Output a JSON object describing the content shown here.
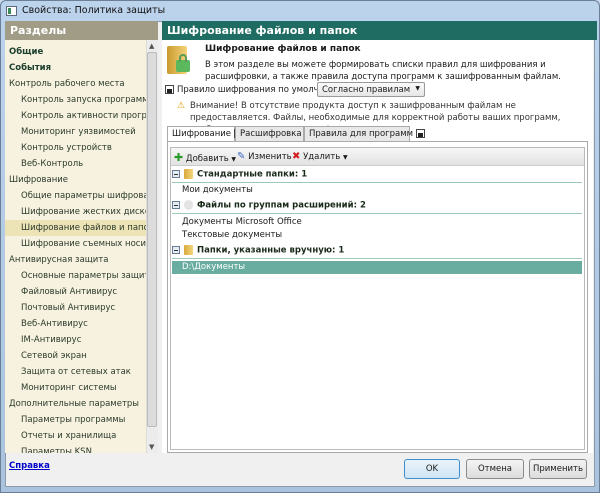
{
  "window": {
    "title": "Свойства: Политика защиты"
  },
  "sidebar": {
    "header": "Разделы",
    "items": [
      {
        "label": "Общие",
        "level": 0,
        "bold": true
      },
      {
        "label": "События",
        "level": 0,
        "bold": true
      },
      {
        "label": "Контроль рабочего места",
        "level": 0
      },
      {
        "label": "Контроль запуска программ",
        "level": 1
      },
      {
        "label": "Контроль активности программ",
        "level": 1
      },
      {
        "label": "Мониторинг уязвимостей",
        "level": 1
      },
      {
        "label": "Контроль устройств",
        "level": 1
      },
      {
        "label": "Веб-Контроль",
        "level": 1
      },
      {
        "label": "Шифрование",
        "level": 0
      },
      {
        "label": "Общие параметры шифрования",
        "level": 1
      },
      {
        "label": "Шифрование жестких дисков",
        "level": 1
      },
      {
        "label": "Шифрование файлов и папок",
        "level": 1,
        "selected": true
      },
      {
        "label": "Шифрование съемных носителей",
        "level": 1
      },
      {
        "label": "Антивирусная защита",
        "level": 0
      },
      {
        "label": "Основные параметры защиты",
        "level": 1
      },
      {
        "label": "Файловый Антивирус",
        "level": 1
      },
      {
        "label": "Почтовый Антивирус",
        "level": 1
      },
      {
        "label": "Веб-Антивирус",
        "level": 1
      },
      {
        "label": "IM-Антивирус",
        "level": 1
      },
      {
        "label": "Сетевой экран",
        "level": 1
      },
      {
        "label": "Защита от сетевых атак",
        "level": 1
      },
      {
        "label": "Мониторинг системы",
        "level": 1
      },
      {
        "label": "Дополнительные параметры",
        "level": 0
      },
      {
        "label": "Параметры программы",
        "level": 1
      },
      {
        "label": "Отчеты и хранилища",
        "level": 1
      },
      {
        "label": "Параметры KSN",
        "level": 1
      }
    ]
  },
  "main": {
    "header": "Шифрование файлов и папок",
    "title": "Шифрование файлов и папок",
    "description": "В этом разделе вы можете формировать списки правил для шифрования и расшифровки, а также правила доступа программ к зашифрованным файлам.",
    "default_rule_label": "Правило шифрования по умолчанию:",
    "default_rule_value": "Согласно правилам",
    "warning": "Внимание! В отсутствие продукта доступ к зашифрованным файлам не предоставляется. Файлы, необходимые для корректной работы ваших программ, необходимо исключить из шифрования.",
    "tabs": [
      "Шифрование",
      "Расшифровка",
      "Правила для программ"
    ],
    "toolbar": {
      "add": "Добавить",
      "edit": "Изменить",
      "delete": "Удалить"
    },
    "groups": [
      {
        "title": "Стандартные папки: 1",
        "items": [
          "Мои документы"
        ]
      },
      {
        "title": "Файлы по группам расширений: 2",
        "items": [
          "Документы Microsoft Office",
          "Текстовые документы"
        ]
      },
      {
        "title": "Папки, указанные вручную: 1",
        "items": [
          "D:\\Документы"
        ]
      }
    ]
  },
  "footer": {
    "help": "Справка",
    "ok": "OK",
    "cancel": "Отмена",
    "apply": "Применить"
  }
}
